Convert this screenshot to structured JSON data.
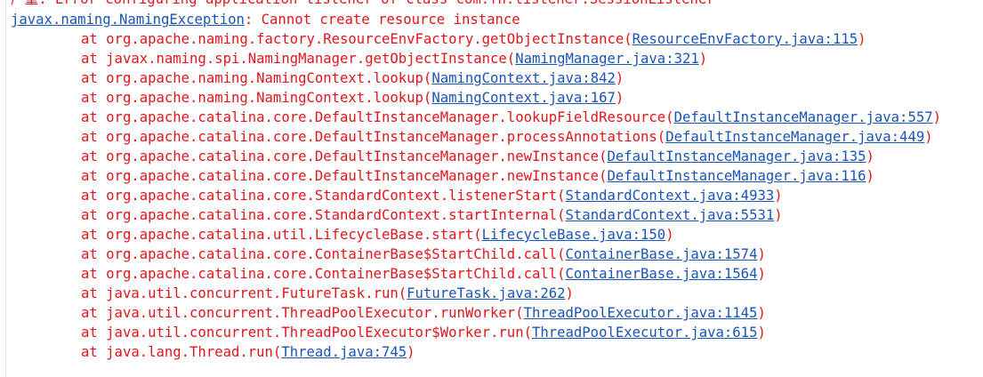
{
  "console": {
    "header_line": "严重: Error configuring application listener of class com.fh.listener.SessionListener",
    "exception": {
      "class_name": "javax.naming.NamingException",
      "message": ": Cannot create resource instance"
    },
    "trace": [
      {
        "prefix": "at org.apache.naming.factory.ResourceEnvFactory.getObjectInstance(",
        "link": "ResourceEnvFactory.java:115",
        "suffix": ")"
      },
      {
        "prefix": "at javax.naming.spi.NamingManager.getObjectInstance(",
        "link": "NamingManager.java:321",
        "suffix": ")"
      },
      {
        "prefix": "at org.apache.naming.NamingContext.lookup(",
        "link": "NamingContext.java:842",
        "suffix": ")"
      },
      {
        "prefix": "at org.apache.naming.NamingContext.lookup(",
        "link": "NamingContext.java:167",
        "suffix": ")"
      },
      {
        "prefix": "at org.apache.catalina.core.DefaultInstanceManager.lookupFieldResource(",
        "link": "DefaultInstanceManager.java:557",
        "suffix": ")"
      },
      {
        "prefix": "at org.apache.catalina.core.DefaultInstanceManager.processAnnotations(",
        "link": "DefaultInstanceManager.java:449",
        "suffix": ")"
      },
      {
        "prefix": "at org.apache.catalina.core.DefaultInstanceManager.newInstance(",
        "link": "DefaultInstanceManager.java:135",
        "suffix": ")"
      },
      {
        "prefix": "at org.apache.catalina.core.DefaultInstanceManager.newInstance(",
        "link": "DefaultInstanceManager.java:116",
        "suffix": ")"
      },
      {
        "prefix": "at org.apache.catalina.core.StandardContext.listenerStart(",
        "link": "StandardContext.java:4933",
        "suffix": ")"
      },
      {
        "prefix": "at org.apache.catalina.core.StandardContext.startInternal(",
        "link": "StandardContext.java:5531",
        "suffix": ")"
      },
      {
        "prefix": "at org.apache.catalina.util.LifecycleBase.start(",
        "link": "LifecycleBase.java:150",
        "suffix": ")"
      },
      {
        "prefix": "at org.apache.catalina.core.ContainerBase$StartChild.call(",
        "link": "ContainerBase.java:1574",
        "suffix": ")"
      },
      {
        "prefix": "at org.apache.catalina.core.ContainerBase$StartChild.call(",
        "link": "ContainerBase.java:1564",
        "suffix": ")"
      },
      {
        "prefix": "at java.util.concurrent.FutureTask.run(",
        "link": "FutureTask.java:262",
        "suffix": ")"
      },
      {
        "prefix": "at java.util.concurrent.ThreadPoolExecutor.runWorker(",
        "link": "ThreadPoolExecutor.java:1145",
        "suffix": ")"
      },
      {
        "prefix": "at java.util.concurrent.ThreadPoolExecutor$Worker.run(",
        "link": "ThreadPoolExecutor.java:615",
        "suffix": ")"
      },
      {
        "prefix": "at java.lang.Thread.run(",
        "link": "Thread.java:745",
        "suffix": ")"
      }
    ],
    "colors": {
      "error_text": "#e1161d",
      "link": "#1a54b9",
      "background": "#ffffff"
    }
  }
}
